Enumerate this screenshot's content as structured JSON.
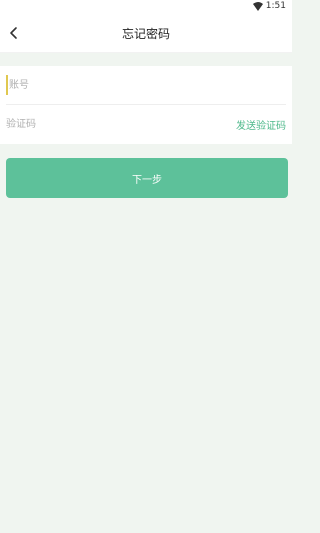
{
  "status_bar": {
    "time": "1:51",
    "wifi_icon": "wifi-icon"
  },
  "header": {
    "back_icon": "chevron-left-icon",
    "title": "忘记密码"
  },
  "form": {
    "account_placeholder": "账号",
    "code_placeholder": "验证码",
    "send_code_label": "发送验证码"
  },
  "next_button_label": "下一步",
  "colors": {
    "accent": "#5dc19a",
    "link": "#4cb88a",
    "background": "#f0f5f0"
  }
}
